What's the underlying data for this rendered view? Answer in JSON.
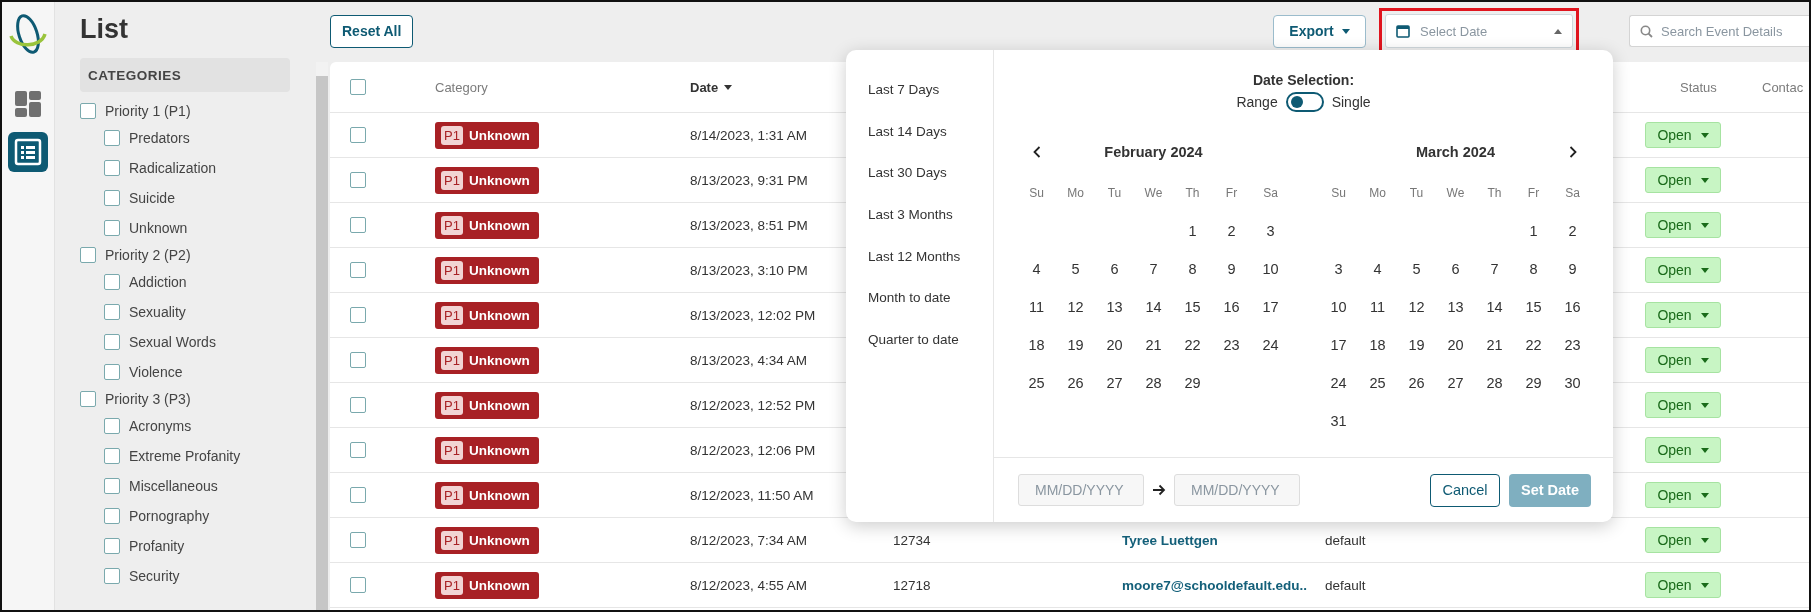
{
  "nav": [
    {
      "kind": "dashboard",
      "selected": false
    },
    {
      "kind": "list",
      "selected": true
    }
  ],
  "page_title": "List",
  "categories": {
    "heading": "CATEGORIES",
    "items": [
      {
        "label": "Priority 1 (P1)",
        "checked": false,
        "children": [
          {
            "label": "Predators",
            "checked": false
          },
          {
            "label": "Radicalization",
            "checked": false
          },
          {
            "label": "Suicide",
            "checked": false
          },
          {
            "label": "Unknown",
            "checked": false
          }
        ]
      },
      {
        "label": "Priority 2 (P2)",
        "checked": false,
        "children": [
          {
            "label": "Addiction",
            "checked": false
          },
          {
            "label": "Sexuality",
            "checked": false
          },
          {
            "label": "Sexual Words",
            "checked": false
          },
          {
            "label": "Violence",
            "checked": false
          }
        ]
      },
      {
        "label": "Priority 3 (P3)",
        "checked": false,
        "children": [
          {
            "label": "Acronyms",
            "checked": false
          },
          {
            "label": "Extreme Profanity",
            "checked": false
          },
          {
            "label": "Miscellaneous",
            "checked": false
          },
          {
            "label": "Pornography",
            "checked": false
          },
          {
            "label": "Profanity",
            "checked": false
          },
          {
            "label": "Security",
            "checked": false
          }
        ]
      }
    ]
  },
  "toolbar": {
    "reset_button": "Reset All",
    "export_button": "Export",
    "date_field": {
      "placeholder": "Select Date",
      "highlighted": true
    },
    "search_field": {
      "placeholder": "Search Event Details"
    }
  },
  "table": {
    "header": {
      "select_all_checked": false,
      "category": "Category",
      "date": "Date",
      "date_sorted": true,
      "status": "Status",
      "column_8": "Contac"
    },
    "rows": [
      {
        "checked": false,
        "priority": "P1",
        "category": "Unknown",
        "date": "8/14/2023, 1:31 AM",
        "status": "Open"
      },
      {
        "checked": false,
        "priority": "P1",
        "category": "Unknown",
        "date": "8/13/2023, 9:31 PM",
        "status": "Open"
      },
      {
        "checked": false,
        "priority": "P1",
        "category": "Unknown",
        "date": "8/13/2023, 8:51 PM",
        "status": "Open"
      },
      {
        "checked": false,
        "priority": "P1",
        "category": "Unknown",
        "date": "8/13/2023, 3:10 PM",
        "status": "Open"
      },
      {
        "checked": false,
        "priority": "P1",
        "category": "Unknown",
        "date": "8/13/2023, 12:02 PM",
        "status": "Open"
      },
      {
        "checked": false,
        "priority": "P1",
        "category": "Unknown",
        "date": "8/13/2023, 4:34 AM",
        "status": "Open"
      },
      {
        "checked": false,
        "priority": "P1",
        "category": "Unknown",
        "date": "8/12/2023, 12:52 PM",
        "status": "Open"
      },
      {
        "checked": false,
        "priority": "P1",
        "category": "Unknown",
        "date": "8/12/2023, 12:06 PM",
        "status": "Open"
      },
      {
        "checked": false,
        "priority": "P1",
        "category": "Unknown",
        "date": "8/12/2023, 11:50 AM",
        "status": "Open"
      },
      {
        "checked": false,
        "priority": "P1",
        "category": "Unknown",
        "date": "8/12/2023, 7:34 AM",
        "column_4": "12734",
        "column_5": "Tyree Luettgen",
        "column_6": "default",
        "status": "Open"
      },
      {
        "checked": false,
        "priority": "P1",
        "category": "Unknown",
        "date": "8/12/2023, 4:55 AM",
        "column_4": "12718",
        "column_5": "moore7@schooldefault.edu..",
        "column_6": "default",
        "status": "Open"
      }
    ]
  },
  "date_picker": {
    "title": "Date Selection:",
    "range_label": "Range",
    "single_label": "Single",
    "single": false,
    "presets": [
      "Last 7 Days",
      "Last 14 Days",
      "Last 30 Days",
      "Last 3 Months",
      "Last 12 Months",
      "Month to date",
      "Quarter to date"
    ],
    "months": [
      {
        "title": "February 2024",
        "weekdays": [
          "Su",
          "Mo",
          "Tu",
          "We",
          "Th",
          "Fr",
          "Sa"
        ],
        "weeks": [
          [
            "1",
            "2",
            "3"
          ],
          [
            "4",
            "5",
            "6",
            "7",
            "8",
            "9",
            "10"
          ],
          [
            "11",
            "12",
            "13",
            "14",
            "15",
            "16",
            "17"
          ],
          [
            "18",
            "19",
            "20",
            "21",
            "22",
            "23",
            "24"
          ],
          [
            "25",
            "26",
            "27",
            "28",
            "29"
          ]
        ]
      },
      {
        "title": "March 2024",
        "weekdays": [
          "Su",
          "Mo",
          "Tu",
          "We",
          "Th",
          "Fr",
          "Sa"
        ],
        "weeks": [
          [
            "1",
            "2"
          ],
          [
            "3",
            "4",
            "5",
            "6",
            "7",
            "8",
            "9"
          ],
          [
            "10",
            "11",
            "12",
            "13",
            "14",
            "15",
            "16"
          ],
          [
            "17",
            "18",
            "19",
            "20",
            "21",
            "22",
            "23"
          ],
          [
            "24",
            "25",
            "26",
            "27",
            "28",
            "29",
            "30"
          ],
          [
            "31"
          ]
        ]
      }
    ],
    "start_placeholder": "MM/DD/YYYY",
    "end_placeholder": "MM/DD/YYYY",
    "cancel_button": "Cancel",
    "set_button": "Set Date",
    "set_disabled": true
  }
}
